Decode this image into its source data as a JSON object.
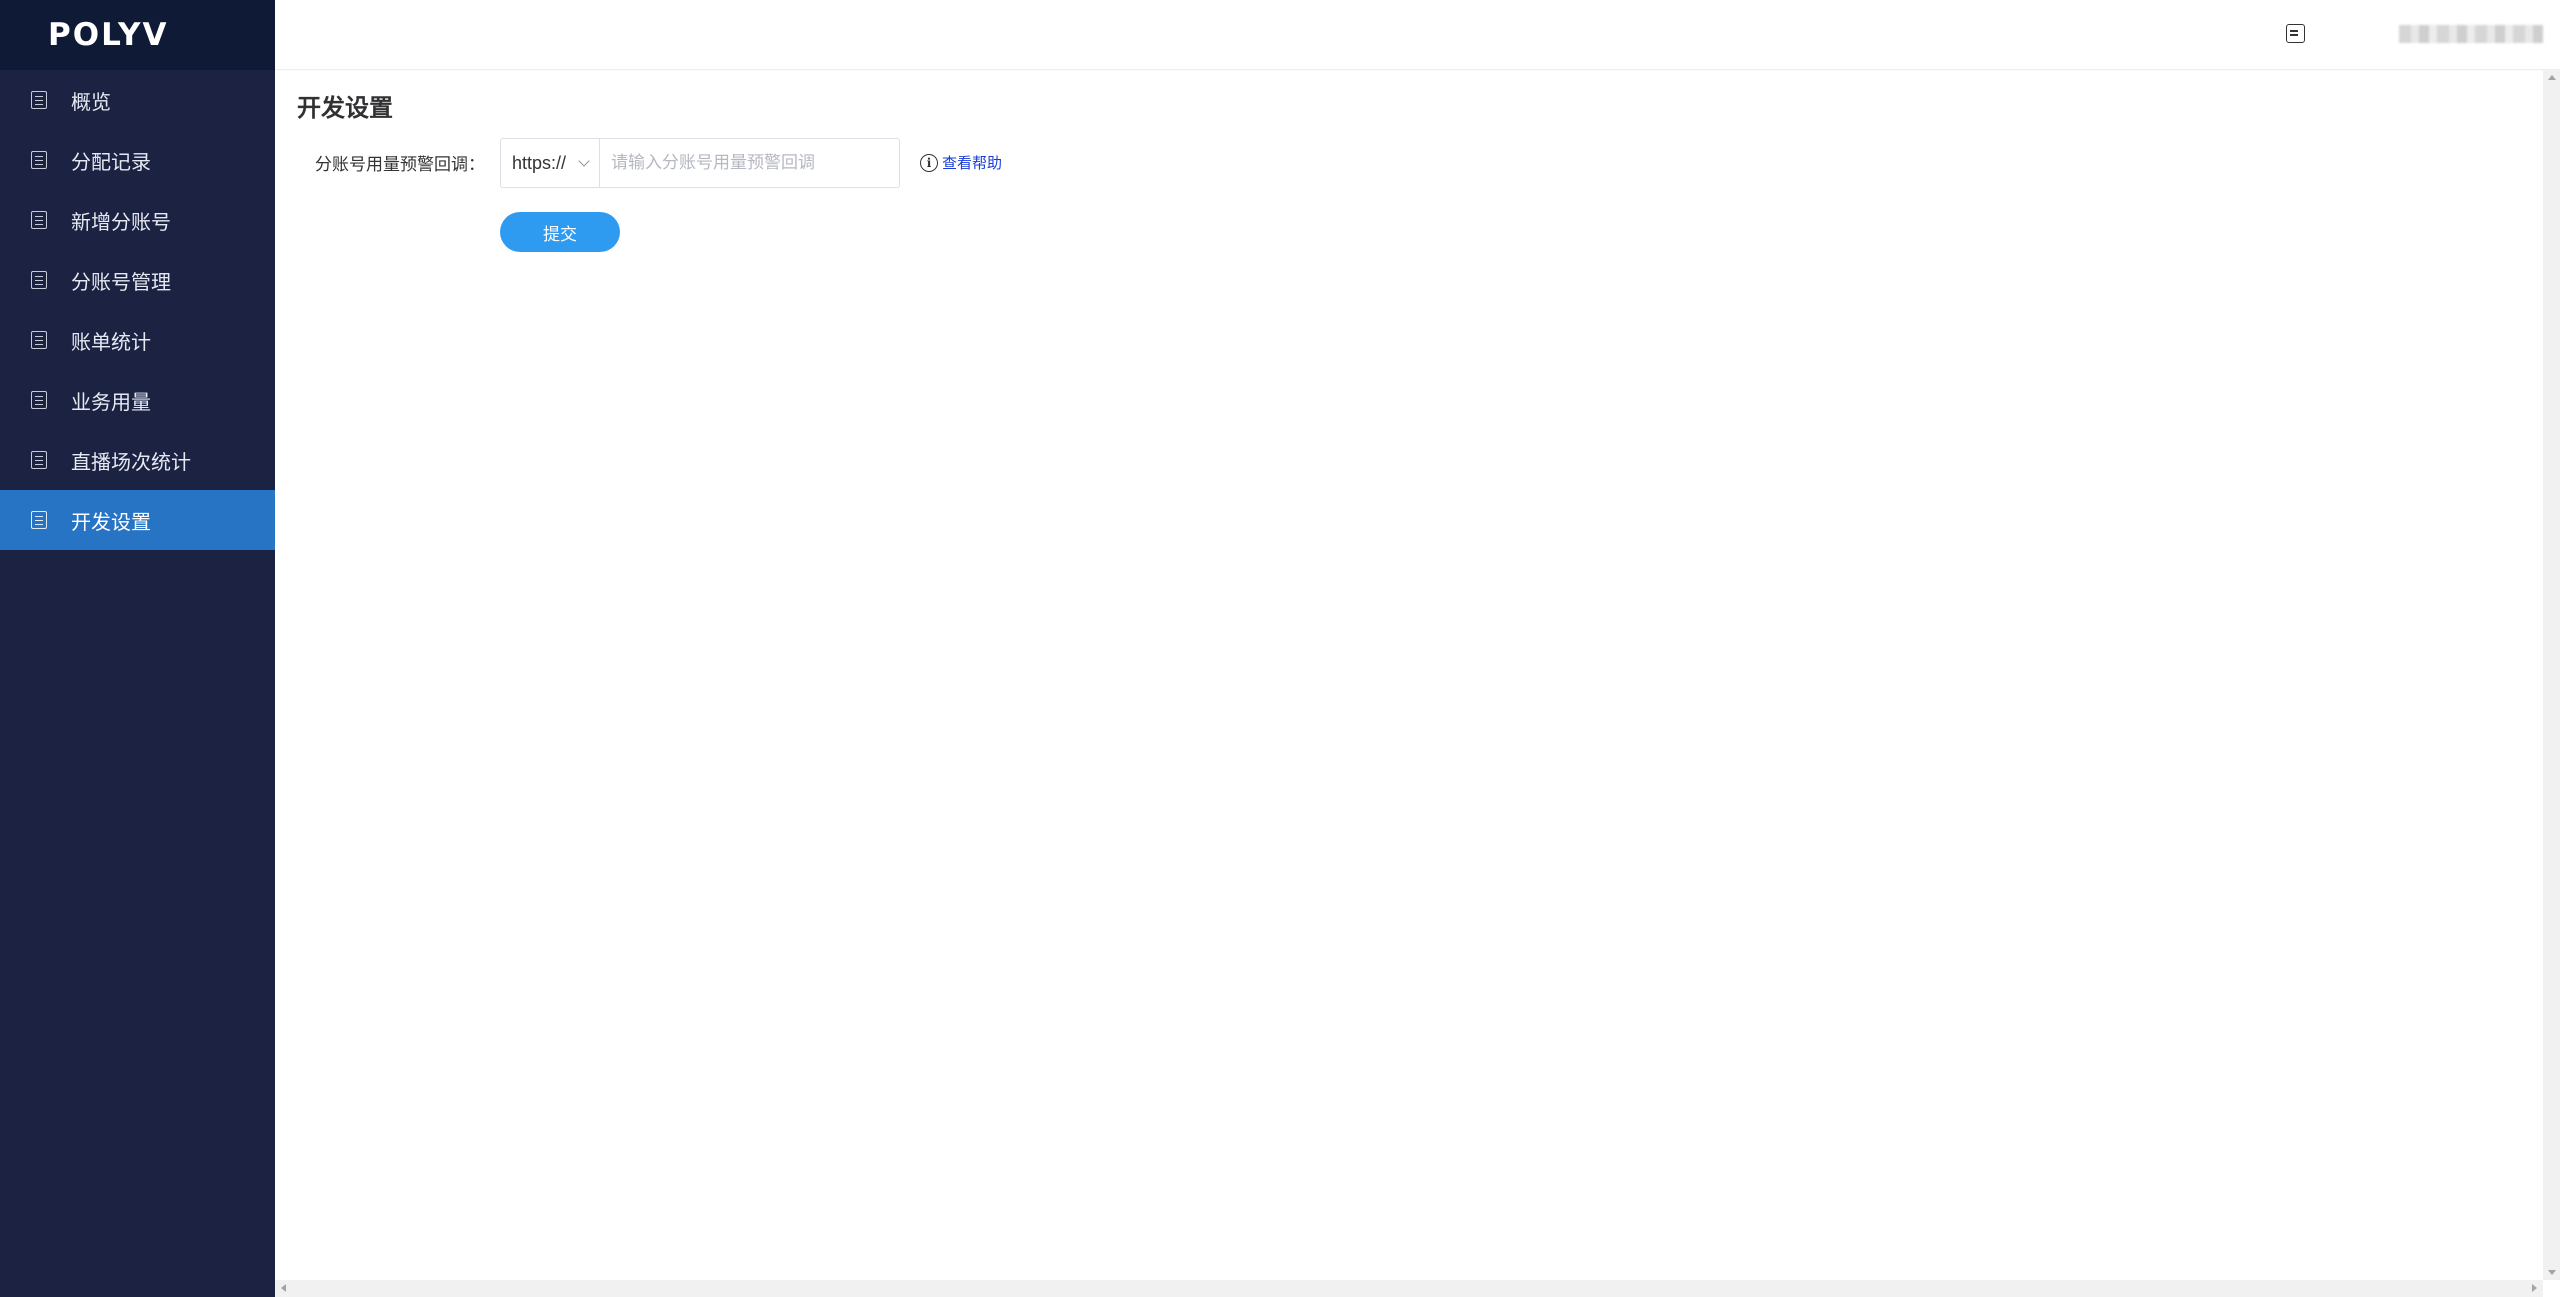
{
  "brand": {
    "logo_text": "POLYV"
  },
  "sidebar": {
    "items": [
      {
        "label": "概览",
        "icon": "document-icon",
        "active": false
      },
      {
        "label": "分配记录",
        "icon": "document-icon",
        "active": false
      },
      {
        "label": "新增分账号",
        "icon": "document-icon",
        "active": false
      },
      {
        "label": "分账号管理",
        "icon": "document-icon",
        "active": false
      },
      {
        "label": "账单统计",
        "icon": "document-icon",
        "active": false
      },
      {
        "label": "业务用量",
        "icon": "document-icon",
        "active": false
      },
      {
        "label": "直播场次统计",
        "icon": "document-icon",
        "active": false
      },
      {
        "label": "开发设置",
        "icon": "document-icon",
        "active": true
      }
    ]
  },
  "header": {
    "message_icon": "message-icon",
    "user_name": ""
  },
  "main": {
    "page_title": "开发设置",
    "form": {
      "label": "分账号用量预警回调：",
      "protocol_selected": "https://",
      "url_value": "",
      "url_placeholder": "请输入分账号用量预警回调",
      "help_link": "查看帮助",
      "submit_label": "提交"
    }
  },
  "colors": {
    "sidebar_bg": "#1b2242",
    "logo_bar_bg": "#0f1a36",
    "active_item_bg": "#2773c4",
    "primary_button": "#2f9bf0",
    "link": "#1a3cd6"
  }
}
